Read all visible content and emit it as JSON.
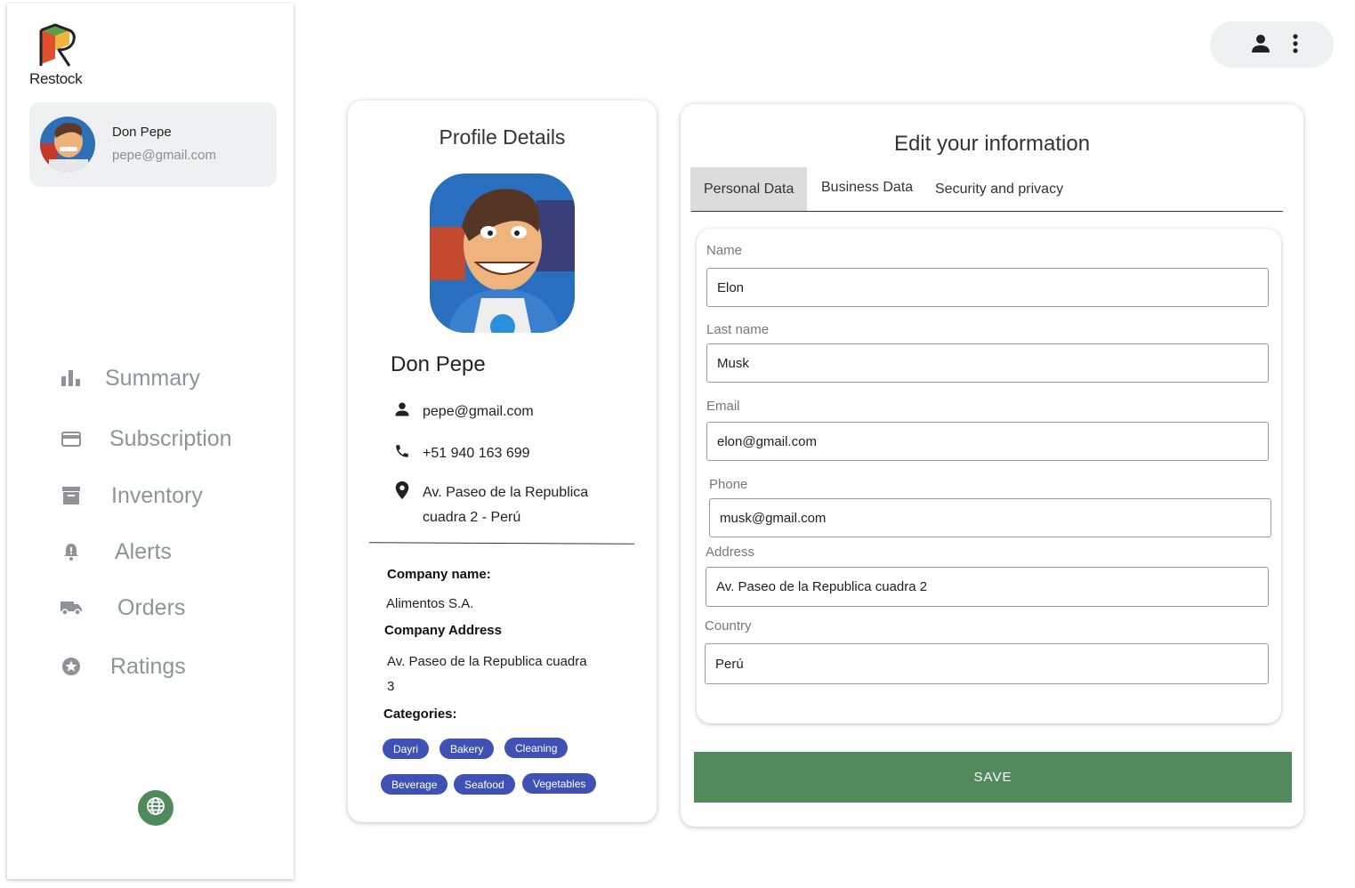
{
  "app": {
    "name": "Restock"
  },
  "sidebar": {
    "user": {
      "name": "Don Pepe",
      "email": "pepe@gmail.com"
    },
    "items": [
      {
        "label": "Summary",
        "icon": "bar-chart-icon"
      },
      {
        "label": "Subscription",
        "icon": "credit-card-icon"
      },
      {
        "label": "Inventory",
        "icon": "archive-icon"
      },
      {
        "label": "Alerts",
        "icon": "bell-alert-icon"
      },
      {
        "label": "Orders",
        "icon": "truck-icon"
      },
      {
        "label": "Ratings",
        "icon": "star-circle-icon"
      }
    ],
    "language_icon": "globe-icon"
  },
  "header": {
    "account_icon": "person-icon",
    "menu_icon": "more-vert-icon"
  },
  "profile": {
    "title": "Profile Details",
    "name": "Don Pepe",
    "email": "pepe@gmail.com",
    "phone": "+51 940 163 699",
    "address_line1": "Av. Paseo de la Republica",
    "address_line2": "cuadra 2 - Perú",
    "company_name_label": "Company name:",
    "company_name": "Alimentos S.A.",
    "company_address_label": "Company Address",
    "company_address_line1": "Av. Paseo de la Republica cuadra",
    "company_address_line2": "3",
    "categories_label": "Categories:",
    "categories": [
      "Dayri",
      "Bakery",
      "Cleaning",
      "Beverage",
      "Seafood",
      "Vegetables"
    ]
  },
  "edit": {
    "title": "Edit your information",
    "tabs": [
      "Personal Data",
      "Business Data",
      "Security and privacy"
    ],
    "active_tab": "Personal Data",
    "fields": {
      "name": {
        "label": "Name",
        "value": "Elon"
      },
      "last_name": {
        "label": "Last name",
        "value": "Musk"
      },
      "email": {
        "label": "Email",
        "value": "elon@gmail.com"
      },
      "phone": {
        "label": "Phone",
        "value": "musk@gmail.com"
      },
      "address": {
        "label": "Address",
        "value": "Av. Paseo de la Republica cuadra 2"
      },
      "country": {
        "label": "Country",
        "value": "Perú"
      }
    },
    "save_label": "SAVE"
  },
  "colors": {
    "accent_green": "#528a5c",
    "chip_blue": "#3f51b5",
    "nav_gray": "#8e9399",
    "card_bg": "#eef0f2"
  }
}
